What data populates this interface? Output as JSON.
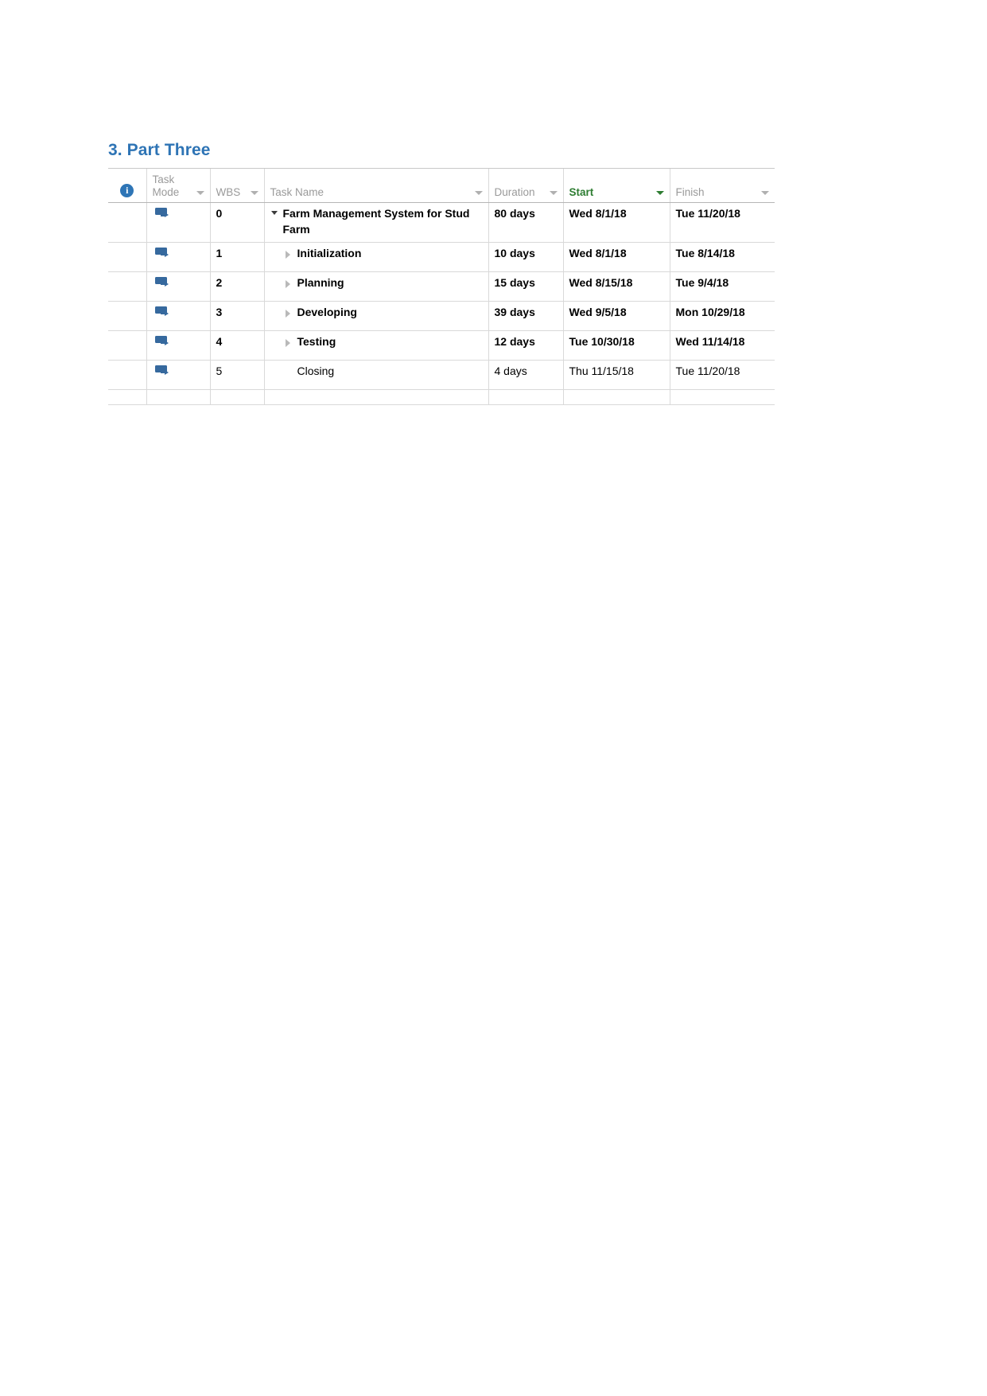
{
  "document": {
    "heading": "3. Part Three"
  },
  "table": {
    "columns": [
      {
        "key": "info",
        "label": "",
        "icon": "info-icon",
        "has_filter": false,
        "selected": false
      },
      {
        "key": "mode",
        "label": "Task Mode",
        "line1": "Task",
        "line2": "Mode",
        "has_filter": true,
        "selected": false
      },
      {
        "key": "wbs",
        "label": "WBS",
        "has_filter": true,
        "selected": false
      },
      {
        "key": "name",
        "label": "Task Name",
        "has_filter": true,
        "selected": false
      },
      {
        "key": "duration",
        "label": "Duration",
        "has_filter": true,
        "selected": false
      },
      {
        "key": "start",
        "label": "Start",
        "has_filter": true,
        "selected": true
      },
      {
        "key": "finish",
        "label": "Finish",
        "has_filter": true,
        "selected": false
      }
    ],
    "selected_column_accent": "#2E7D32",
    "selected_column_background": "#e0e0e0",
    "rows": [
      {
        "mode_icon": "auto-scheduled-icon",
        "wbs": "0",
        "name": "Farm Management System for Stud Farm",
        "level": 0,
        "toggle": "collapse",
        "bold": true,
        "duration": "80 days",
        "start": "Wed 8/1/18",
        "finish": "Tue 11/20/18"
      },
      {
        "mode_icon": "auto-scheduled-icon",
        "wbs": "1",
        "name": "Initialization",
        "level": 1,
        "toggle": "expand",
        "bold": true,
        "duration": "10 days",
        "start": "Wed 8/1/18",
        "finish": "Tue 8/14/18"
      },
      {
        "mode_icon": "auto-scheduled-icon",
        "wbs": "2",
        "name": "Planning",
        "level": 1,
        "toggle": "expand",
        "bold": true,
        "duration": "15 days",
        "start": "Wed 8/15/18",
        "finish": "Tue 9/4/18"
      },
      {
        "mode_icon": "auto-scheduled-icon",
        "wbs": "3",
        "name": "Developing",
        "level": 1,
        "toggle": "expand",
        "bold": true,
        "duration": "39 days",
        "start": "Wed 9/5/18",
        "finish": "Mon 10/29/18"
      },
      {
        "mode_icon": "auto-scheduled-icon",
        "wbs": "4",
        "name": "Testing",
        "level": 1,
        "toggle": "expand",
        "bold": true,
        "duration": "12 days",
        "start": "Tue 10/30/18",
        "finish": "Wed 11/14/18"
      },
      {
        "mode_icon": "auto-scheduled-icon",
        "wbs": "5",
        "name": "Closing",
        "level": 1,
        "toggle": "none",
        "bold": false,
        "duration": "4 days",
        "start": "Thu 11/15/18",
        "finish": "Tue 11/20/18"
      }
    ]
  }
}
